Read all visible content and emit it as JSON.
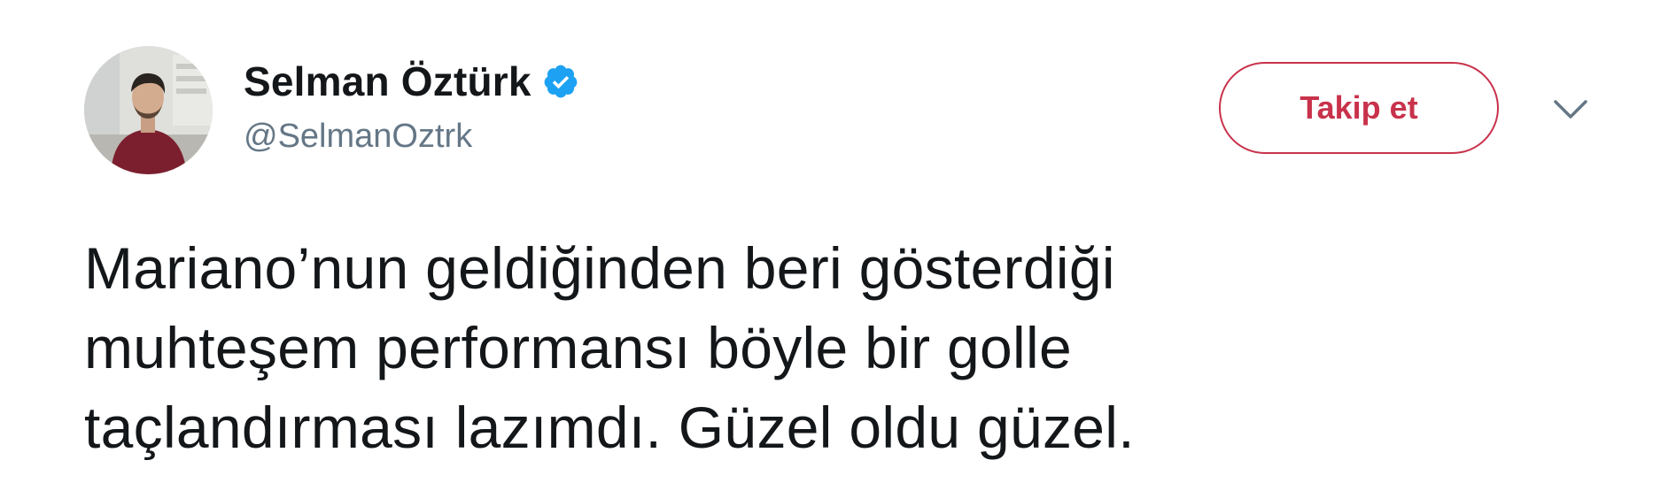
{
  "author": {
    "display_name": "Selman Öztürk",
    "handle": "@SelmanOztrk",
    "verified": true,
    "avatar_icon": "profile-photo"
  },
  "actions": {
    "follow_label": "Takip et",
    "menu_icon": "chevron-down-icon"
  },
  "tweet": {
    "lines": [
      "Mariano’nun geldiğinden beri gösterdiği",
      "muhteşem performansı böyle bir golle",
      "taçlandırması lazımdı. Güzel oldu güzel."
    ]
  },
  "colors": {
    "follow_accent": "#c8324b",
    "verified_badge": "#1da1f2",
    "handle_text": "#657786",
    "body_text": "#14171a"
  }
}
